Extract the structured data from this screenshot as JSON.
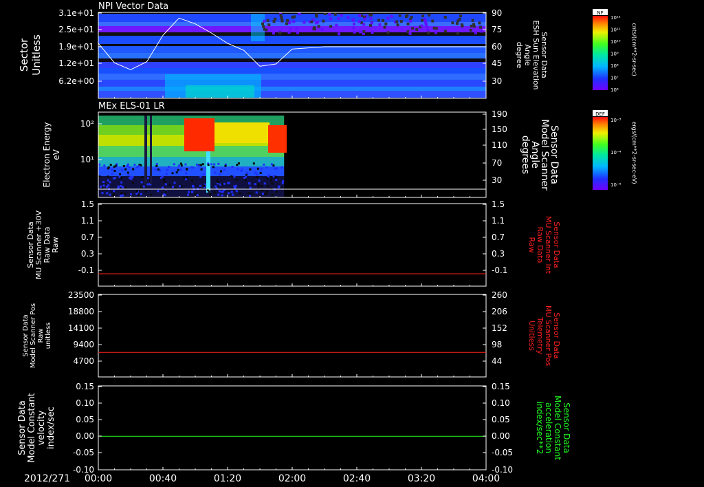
{
  "time_axis": {
    "date": "2012/271",
    "ticks": [
      "00:00",
      "00:40",
      "01:20",
      "02:00",
      "02:40",
      "03:20",
      "04:00"
    ]
  },
  "panels": {
    "npi": {
      "title": "NPI Vector Data",
      "left_labels": [
        "Sector",
        "Unitless"
      ],
      "left_ticks": [
        "3.1e+01",
        "2.5e+01",
        "1.9e+01",
        "1.2e+01",
        "6.2e+00"
      ],
      "right_labels": [
        "Sensor Data",
        "ESH Sun Elevation",
        "Angle",
        "degree"
      ],
      "right_ticks": [
        "90",
        "75",
        "60",
        "45",
        "30"
      ]
    },
    "els": {
      "title": "MEx ELS-01 LR",
      "left_labels": [
        "Electron Energy",
        "eV"
      ],
      "left_ticks": [
        "10²",
        "10¹"
      ],
      "right_labels": [
        "Sensor Data",
        "Model Scanner",
        "Angle",
        "degrees"
      ],
      "right_ticks": [
        "190",
        "150",
        "110",
        "70",
        "30"
      ]
    },
    "mu_raw": {
      "left_labels": [
        "Sensor Data",
        "MU Scanner +30V",
        "Raw Data",
        "Raw"
      ],
      "left_ticks": [
        "1.5",
        "1.1",
        "0.7",
        "0.3",
        "-0.1"
      ],
      "right_labels": [
        "Sensor Data",
        "MU Scanner Int",
        "Raw Data",
        "Raw"
      ],
      "right_ticks": [
        "1.5",
        "1.1",
        "0.7",
        "0.3",
        "-0.1"
      ]
    },
    "pos": {
      "left_labels": [
        "Sensor Data",
        "Model Scanner Pos",
        "Raw",
        "unitless"
      ],
      "left_ticks": [
        "23500",
        "18800",
        "14100",
        "9400",
        "4700"
      ],
      "right_labels": [
        "Sensor Data",
        "MU Scanner Pos",
        "Telemetry",
        "Unitless"
      ],
      "right_ticks": [
        "260",
        "206",
        "152",
        "98",
        "44"
      ]
    },
    "vel": {
      "left_labels": [
        "Sensor Data",
        "Model Constant",
        "velocity",
        "index/sec"
      ],
      "left_ticks": [
        "0.15",
        "0.10",
        "0.05",
        "0.00",
        "-0.05",
        "-0.10"
      ],
      "right_labels": [
        "Sensor Data",
        "Model Constant",
        "acceleration",
        "index/sec**2"
      ],
      "right_ticks": [
        "0.15",
        "0.10",
        "0.05",
        "0.00",
        "-0.05",
        "-0.10"
      ]
    }
  },
  "colorbars": {
    "nf": {
      "title": "NF",
      "unit": "cnts/(cm**2-sr-sec)",
      "ticks": [
        "10¹²",
        "10¹¹",
        "10¹⁰",
        "10⁹",
        "10⁸",
        "10⁷",
        "10⁶"
      ]
    },
    "def": {
      "title": "DEF",
      "unit": "ergs/(cm**2-sr-sec-eV)",
      "ticks": [
        "10⁻³",
        "10⁻⁴",
        "10⁻⁵"
      ]
    }
  },
  "colors": {
    "axis": "#ffffff",
    "red_series": "#ff2020",
    "green_series": "#20ff20",
    "right_label_red": "#ff2020",
    "right_label_green": "#20ff20"
  },
  "chart_data": [
    {
      "type": "heatmap",
      "title": "NPI Vector Data",
      "x_range": [
        "00:00",
        "04:00"
      ],
      "ylabel": "Sector Unitless",
      "y2label": "Sensor Data ESH Sun Elevation Angle degree",
      "y2lim": [
        15,
        90
      ],
      "overlay_line": {
        "x": [
          "00:00",
          "00:10",
          "00:20",
          "00:30",
          "00:40",
          "00:50",
          "01:00",
          "01:10",
          "01:20",
          "01:30",
          "01:40",
          "01:50",
          "02:00",
          "02:20",
          "02:40",
          "03:00",
          "03:20",
          "03:40",
          "04:00"
        ],
        "y": [
          63,
          46,
          40,
          47,
          70,
          85,
          80,
          72,
          63,
          57,
          43,
          45,
          58,
          60,
          60,
          60,
          60,
          60,
          60
        ]
      }
    },
    {
      "type": "heatmap",
      "title": "MEx ELS-01 LR",
      "x_range": [
        "00:00",
        "04:00"
      ],
      "data_end": "01:55",
      "ylabel": "Electron Energy eV",
      "yscale": "log",
      "y2label": "Sensor Data Model Scanner Angle degrees",
      "y2lim": [
        0,
        190
      ],
      "overlay_line": {
        "x": [
          "00:00",
          "04:00"
        ],
        "y": [
          5,
          5
        ]
      }
    },
    {
      "type": "line",
      "x_range": [
        "00:00",
        "04:00"
      ],
      "ylim": [
        -0.3,
        1.5
      ],
      "series": [
        {
          "x": [
            "00:00",
            "04:00"
          ],
          "values": [
            -0.03,
            -0.03
          ],
          "color": "#ff2020"
        }
      ]
    },
    {
      "type": "line",
      "x_range": [
        "00:00",
        "04:00"
      ],
      "ylim": [
        0,
        23500
      ],
      "series": [
        {
          "x": [
            "00:00",
            "04:00"
          ],
          "values": [
            7000,
            7000
          ],
          "color": "#ff2020"
        }
      ]
    },
    {
      "type": "line",
      "x_range": [
        "00:00",
        "04:00"
      ],
      "ylim": [
        -0.1,
        0.15
      ],
      "series": [
        {
          "x": [
            "00:00",
            "04:00"
          ],
          "values": [
            0.0,
            0.0
          ],
          "color": "#20ff20"
        }
      ]
    }
  ]
}
